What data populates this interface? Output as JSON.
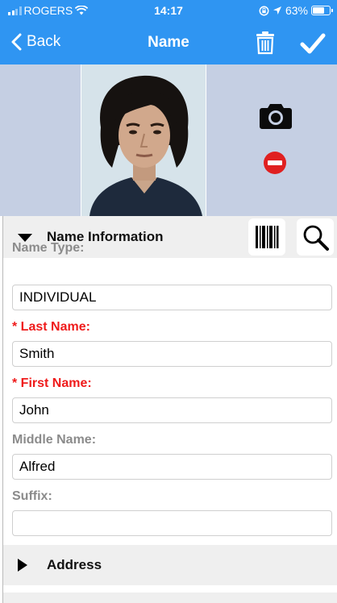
{
  "status_bar": {
    "carrier": "ROGERS",
    "time": "14:17",
    "battery_percent": "63%",
    "battery_level": 0.63
  },
  "nav": {
    "back_label": "Back",
    "title": "Name"
  },
  "photo": {
    "description_icon": "person-photo"
  },
  "name_section": {
    "title": "Name Information",
    "expanded": true,
    "fields": [
      {
        "label": "Name Type:",
        "value": "INDIVIDUAL",
        "required": false
      },
      {
        "label": "* Last Name:",
        "value": "Smith",
        "required": true
      },
      {
        "label": "* First Name:",
        "value": "John",
        "required": true
      },
      {
        "label": "Middle Name:",
        "value": "Alfred",
        "required": false
      },
      {
        "label": "Suffix:",
        "value": "",
        "required": false
      }
    ]
  },
  "address_section": {
    "title": "Address",
    "expanded": false
  },
  "colors": {
    "header_blue": "#2f95f2",
    "required_red": "#ef1b1b",
    "label_gray": "#8b8b8b",
    "photo_bg": "#c5cfe3",
    "section_bg": "#efefef",
    "remove_red": "#e02020"
  },
  "icons": [
    "signal-icon",
    "wifi-icon",
    "lock-rotation-icon",
    "location-icon",
    "battery-icon",
    "chevron-left-icon",
    "trash-icon",
    "checkmark-icon",
    "camera-icon",
    "remove-icon",
    "triangle-down-icon",
    "barcode-icon",
    "search-icon",
    "triangle-right-icon"
  ]
}
